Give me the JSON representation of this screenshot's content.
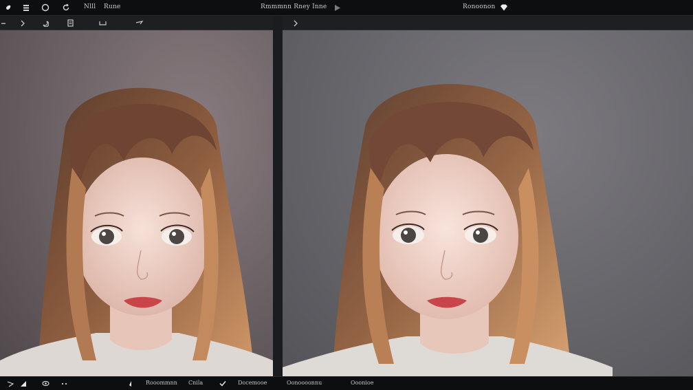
{
  "topbar": {
    "menu_1": "Nlll",
    "menu_2": "Rune",
    "title": "Rmmmnn Rney Inne",
    "right_label": "Ronoonon"
  },
  "statusbar": {
    "item_1": "Rooommnn",
    "item_2": "Cnila",
    "item_3": "Docemooe",
    "item_4": "Oonoooonnu",
    "item_5": "Ooonioe"
  },
  "portrait": {
    "hair_color": "#7a4f36",
    "hair_highlight": "#c88f64",
    "skin_color": "#f0d6cc",
    "lip_color": "#c8454a"
  }
}
